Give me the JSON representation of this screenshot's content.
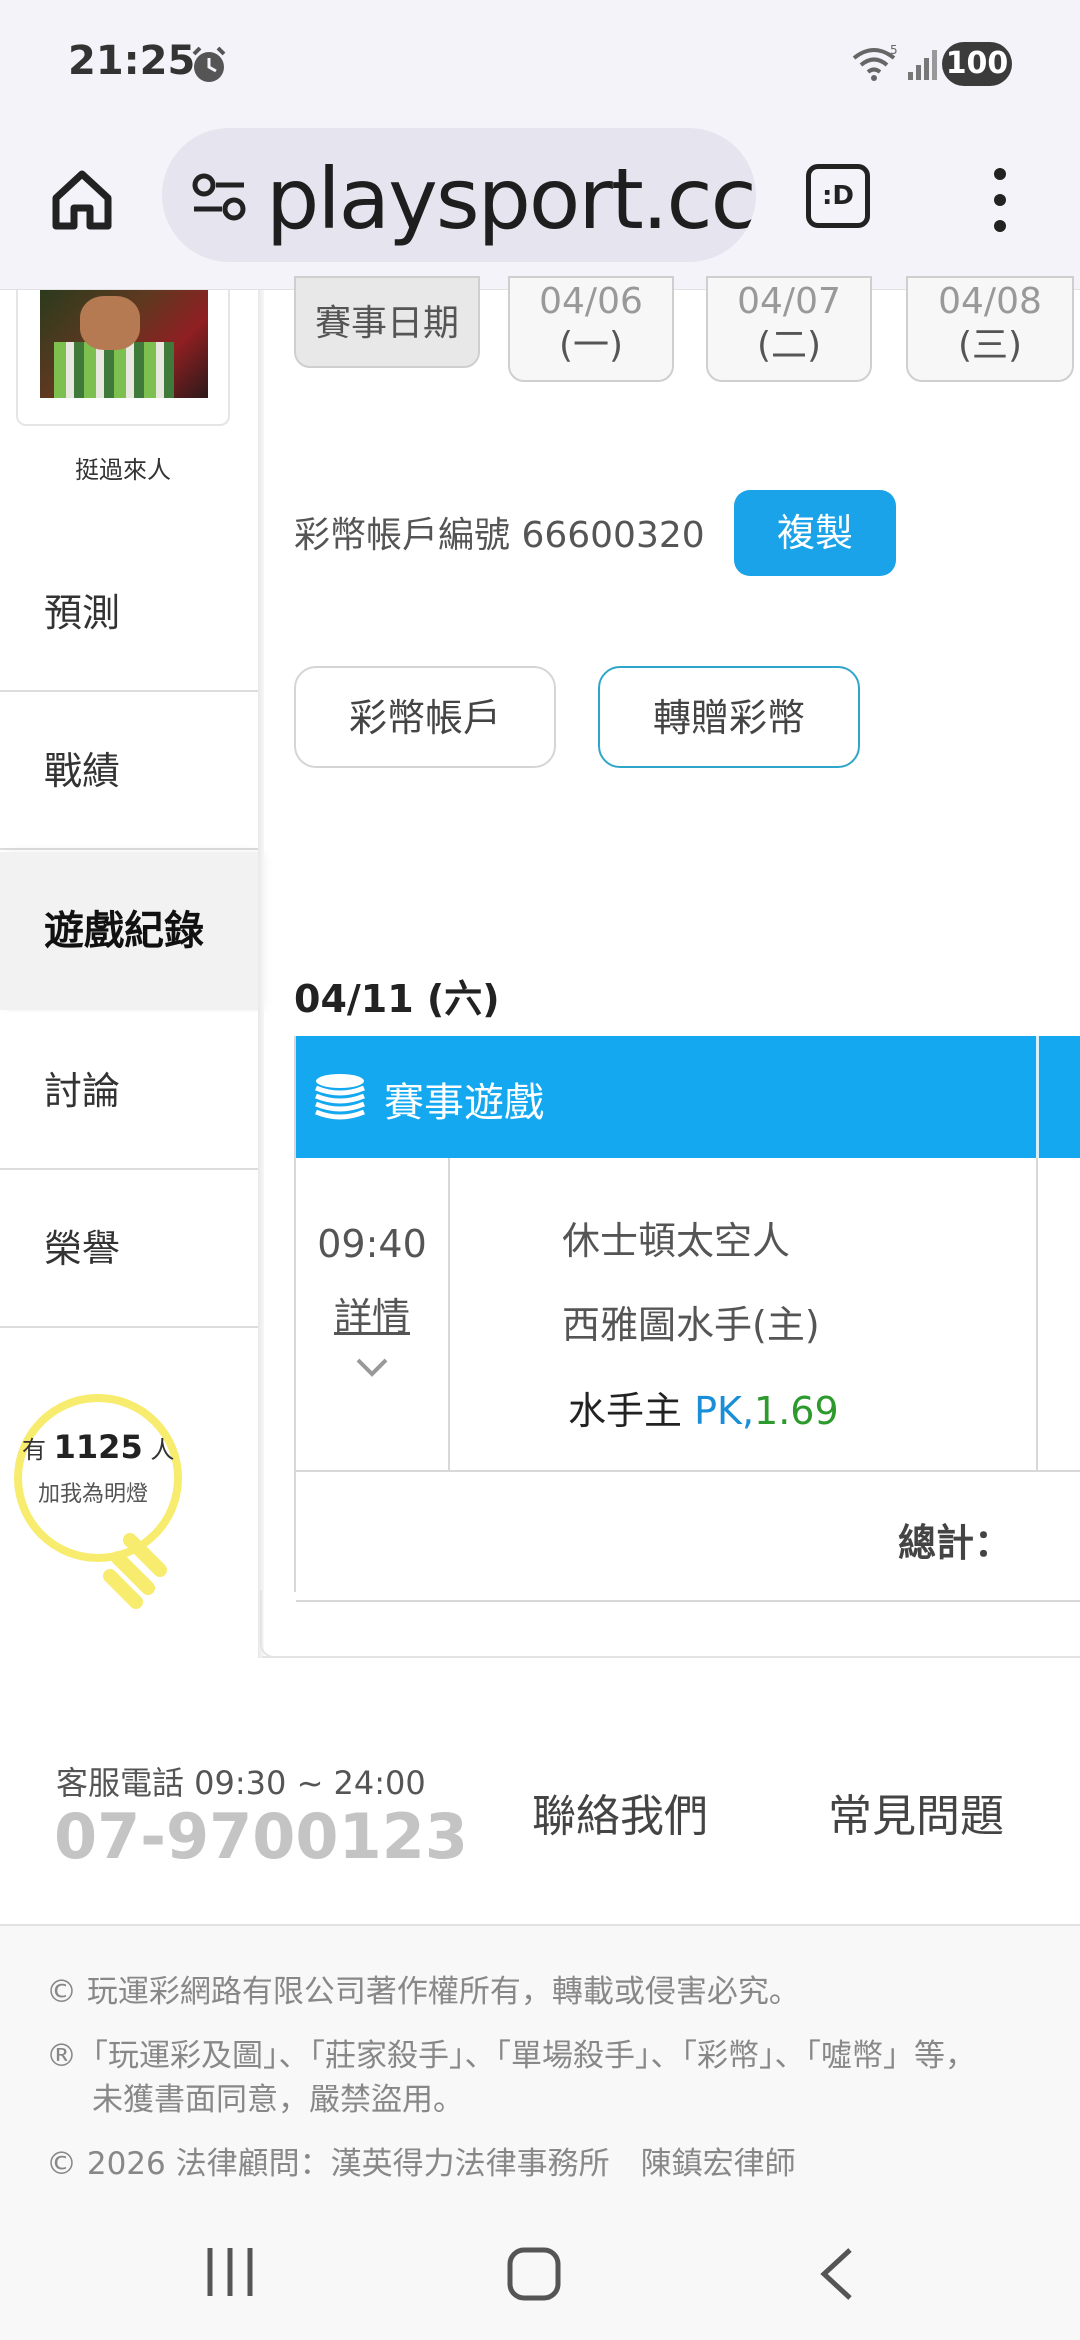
{
  "status_bar": {
    "time": "21:25",
    "battery": "100"
  },
  "browser": {
    "url": "playsport.cc",
    "tabs_label": ":D"
  },
  "sidebar": {
    "username": "挺過來人",
    "items": [
      {
        "label": "預測"
      },
      {
        "label": "戰績"
      },
      {
        "label": "遊戲紀錄"
      },
      {
        "label": "討論"
      },
      {
        "label": "榮譽"
      }
    ],
    "fans": {
      "prefix": "有",
      "count": "1125",
      "suffix": "人",
      "cta": "加我為明燈"
    }
  },
  "date_bar": {
    "label": "賽事日期",
    "dates": [
      {
        "date": "04/06",
        "weekday": "(一)"
      },
      {
        "date": "04/07",
        "weekday": "(二)"
      },
      {
        "date": "04/08",
        "weekday": "(三)"
      }
    ]
  },
  "account": {
    "label": "彩幣帳戶編號 66600320",
    "copy_label": "複製",
    "coin_account_label": "彩幣帳戶",
    "transfer_label": "轉贈彩幣"
  },
  "games": {
    "day_heading": "04/11 (六)",
    "table_title": "賽事遊戲",
    "rows": [
      {
        "time": "09:40",
        "details_label": "詳情",
        "away_team": "休士頓太空人",
        "home_team": "西雅圖水手(主)",
        "pick": "水手主",
        "pick_type": "PK,",
        "pick_odds": "1.69"
      }
    ],
    "total_label": "總計："
  },
  "footer": {
    "service_hours": "客服電話 09:30 ~ 24:00",
    "phone": "07-9700123",
    "contact_label": "聯絡我們",
    "faq_label": "常見問題",
    "legal": [
      "© 玩運彩網路有限公司著作權所有，轉載或侵害必究。",
      "®「玩運彩及圖」、「莊家殺手」、「單場殺手」、「彩幣」、「噓幣」等，",
      "未獲書面同意，嚴禁盜用。",
      "© 2026 法律顧問：漢英得力法律事務所　陳鎮宏律師"
    ]
  },
  "colors": {
    "accent_blue": "#13a8ef",
    "copy_button": "#1aa3e8",
    "transfer_border": "#2fa6c9",
    "pk_text": "#1a8fd8",
    "odds_text": "#2d9a2d",
    "bulb_yellow": "#f7ec6e"
  }
}
